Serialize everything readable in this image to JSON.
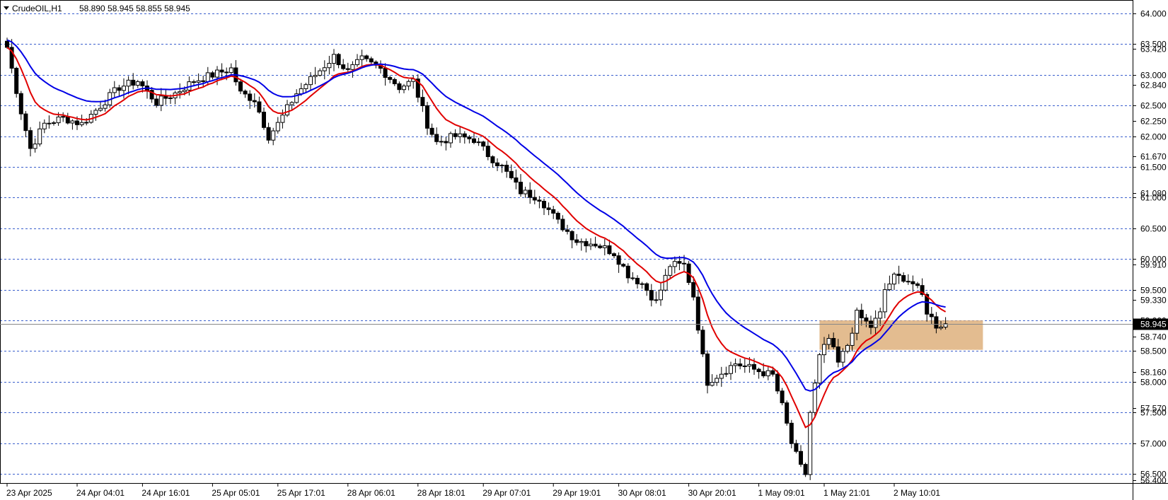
{
  "header": {
    "symbol": "CrudeOIL,H1",
    "ohlc": "58.890 58.945 58.855 58.945"
  },
  "colors": {
    "background": "#ffffff",
    "grid": "#3a5fcd",
    "candle_bull": "#ffffff",
    "candle_bear": "#000000",
    "candle_outline": "#000000",
    "ma_fast": "#e00000",
    "ma_slow": "#0000e6",
    "zone": "#d9a66b"
  },
  "chart_data": {
    "type": "candlestick",
    "symbol": "CrudeOIL",
    "timeframe": "H1",
    "ylim": [
      56.35,
      64.22
    ],
    "grid": true,
    "price_levels": [
      "64.000",
      "63.500",
      "63.000",
      "62.500",
      "62.000",
      "61.500",
      "61.000",
      "60.500",
      "60.000",
      "59.500",
      "59.000",
      "58.500",
      "58.000",
      "57.500",
      "57.000",
      "56.500"
    ],
    "price_ticks": [
      "63.420",
      "62.840",
      "62.250",
      "61.670",
      "61.080",
      "59.910",
      "59.330",
      "58.740",
      "58.160",
      "57.570",
      "56.400"
    ],
    "current_price_label": "58.945",
    "x_labels": [
      "23 Apr 2025",
      "24 Apr 04:01",
      "24 Apr 16:01",
      "25 Apr 05:01",
      "25 Apr 17:01",
      "28 Apr 06:01",
      "28 Apr 18:01",
      "29 Apr 07:01",
      "29 Apr 19:01",
      "30 Apr 08:01",
      "30 Apr 20:01",
      "1 May 09:01",
      "1 May 21:01",
      "2 May 10:01"
    ],
    "zone": {
      "x_start_bar": 174,
      "x_end_bar": 209,
      "y_top": 59.0,
      "y_bottom": 58.52
    },
    "close_waypoints": [
      [
        0,
        63.45
      ],
      [
        3,
        62.4
      ],
      [
        5,
        61.8
      ],
      [
        8,
        62.2
      ],
      [
        12,
        62.3
      ],
      [
        16,
        62.2
      ],
      [
        20,
        62.5
      ],
      [
        24,
        62.8
      ],
      [
        28,
        62.9
      ],
      [
        32,
        62.55
      ],
      [
        36,
        62.7
      ],
      [
        40,
        62.9
      ],
      [
        44,
        63.0
      ],
      [
        48,
        63.1
      ],
      [
        50,
        62.7
      ],
      [
        53,
        62.6
      ],
      [
        56,
        62.0
      ],
      [
        58,
        62.2
      ],
      [
        62,
        62.7
      ],
      [
        66,
        63.0
      ],
      [
        70,
        63.3
      ],
      [
        73,
        63.05
      ],
      [
        76,
        63.25
      ],
      [
        80,
        63.1
      ],
      [
        84,
        62.8
      ],
      [
        87,
        62.9
      ],
      [
        90,
        62.2
      ],
      [
        92,
        61.9
      ],
      [
        96,
        62.0
      ],
      [
        100,
        61.95
      ],
      [
        103,
        61.7
      ],
      [
        106,
        61.5
      ],
      [
        110,
        61.1
      ],
      [
        114,
        61.0
      ],
      [
        118,
        60.6
      ],
      [
        122,
        60.3
      ],
      [
        126,
        60.25
      ],
      [
        130,
        60.1
      ],
      [
        133,
        59.75
      ],
      [
        136,
        59.6
      ],
      [
        139,
        59.3
      ],
      [
        142,
        59.9
      ],
      [
        145,
        59.9
      ],
      [
        147,
        59.4
      ],
      [
        149,
        58.4
      ],
      [
        150,
        58.0
      ],
      [
        153,
        58.15
      ],
      [
        156,
        58.3
      ],
      [
        160,
        58.2
      ],
      [
        164,
        58.1
      ],
      [
        166,
        57.6
      ],
      [
        168,
        57.0
      ],
      [
        170,
        56.6
      ],
      [
        171,
        56.5
      ],
      [
        172,
        57.5
      ],
      [
        174,
        58.4
      ],
      [
        176,
        58.7
      ],
      [
        178,
        58.3
      ],
      [
        180,
        58.6
      ],
      [
        182,
        59.1
      ],
      [
        185,
        58.9
      ],
      [
        187,
        59.1
      ],
      [
        188,
        59.5
      ],
      [
        190,
        59.7
      ],
      [
        192,
        59.7
      ],
      [
        194,
        59.6
      ],
      [
        196,
        59.4
      ],
      [
        197,
        59.15
      ],
      [
        199,
        58.92
      ],
      [
        201,
        58.945
      ]
    ]
  }
}
